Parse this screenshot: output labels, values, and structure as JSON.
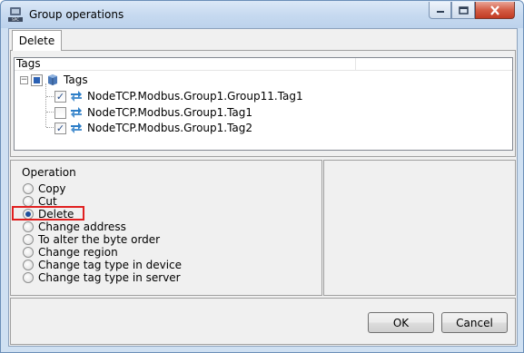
{
  "window": {
    "title": "Group operations"
  },
  "tabs": [
    {
      "label": "Delete"
    }
  ],
  "tree": {
    "column_header": "Tags",
    "root": {
      "label": "Tags",
      "expander": "−"
    },
    "items": [
      {
        "label": "NodeTCP.Modbus.Group1.Group11.Tag1",
        "checked": true
      },
      {
        "label": "NodeTCP.Modbus.Group1.Tag1",
        "checked": false
      },
      {
        "label": "NodeTCP.Modbus.Group1.Tag2",
        "checked": true
      }
    ]
  },
  "operation": {
    "label": "Operation",
    "options": [
      {
        "label": "Copy",
        "selected": false
      },
      {
        "label": "Cut",
        "selected": false
      },
      {
        "label": "Delete",
        "selected": true
      },
      {
        "label": "Change address",
        "selected": false
      },
      {
        "label": "To alter the byte order",
        "selected": false
      },
      {
        "label": "Change region",
        "selected": false
      },
      {
        "label": "Change tag type in device",
        "selected": false
      },
      {
        "label": "Change tag type in server",
        "selected": false
      }
    ]
  },
  "buttons": {
    "ok": "OK",
    "cancel": "Cancel"
  },
  "colors": {
    "highlight": "#e02020",
    "titlebar": "#c7daf0",
    "close_button": "#c13a22"
  }
}
